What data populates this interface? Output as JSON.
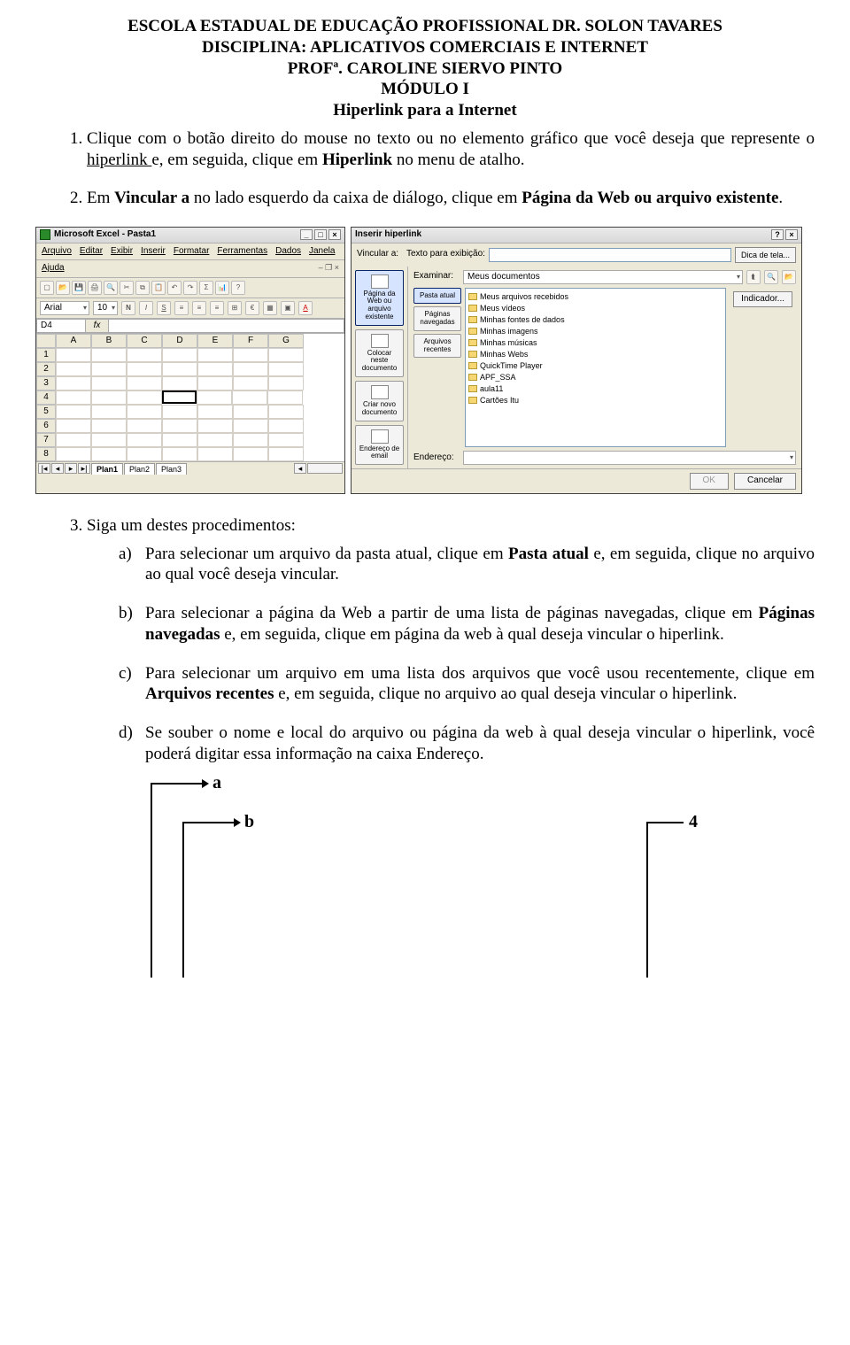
{
  "header": {
    "school": "ESCOLA ESTADUAL DE EDUCAÇÃO PROFISSIONAL DR. SOLON  TAVARES",
    "discipline": "DISCIPLINA: APLICATIVOS COMERCIAIS E INTERNET",
    "prof": "PROFª. CAROLINE SIERVO PINTO",
    "module": "MÓDULO I",
    "title": "Hiperlink para a Internet"
  },
  "steps": {
    "s1_pre": "Clique com o botão direito do mouse no texto ou no elemento gráfico que você deseja que represente o ",
    "s1_link": "hiperlink ",
    "s1_mid": "e, em seguida, clique em ",
    "s1_bold": "Hiperlink",
    "s1_post": " no menu de atalho.",
    "s2_pre": "Em ",
    "s2_b1": "Vincular a",
    "s2_mid": " no lado esquerdo da caixa de diálogo, clique em ",
    "s2_b2": "Página da Web ou arquivo existente",
    "s2_post": ".",
    "s3": "Siga um destes procedimentos:",
    "a_pre": "Para selecionar um arquivo da pasta atual, clique em ",
    "a_b": "Pasta atual",
    "a_post": " e, em seguida, clique no arquivo ao qual você deseja vincular.",
    "b_pre": "Para selecionar a página da Web a partir de uma lista de páginas navegadas, clique em ",
    "b_b": "Páginas navegadas",
    "b_post": " e, em seguida, clique em página da web à qual deseja vincular o hiperlink.",
    "c_pre": "Para selecionar um arquivo em uma lista dos arquivos que você usou recentemente, clique em ",
    "c_b": "Arquivos recentes",
    "c_post": " e, em seguida, clique no arquivo ao qual deseja vincular o hiperlink.",
    "d": "Se souber o nome e local do arquivo ou página da web à qual deseja vincular o hiperlink, você poderá digitar essa informação na caixa Endereço."
  },
  "diagram": {
    "a": "a",
    "b": "b",
    "four": "4"
  },
  "excel": {
    "title": "Microsoft Excel - Pasta1",
    "menus": [
      "Arquivo",
      "Editar",
      "Exibir",
      "Inserir",
      "Formatar",
      "Ferramentas",
      "Dados",
      "Janela",
      "Ajuda"
    ],
    "font": "Arial",
    "size": "10",
    "namebox": "D4",
    "fx": "fx",
    "cols": [
      "A",
      "B",
      "C",
      "D",
      "E",
      "F",
      "G"
    ],
    "rows": [
      "1",
      "2",
      "3",
      "4",
      "5",
      "6",
      "7",
      "8"
    ],
    "sheets": [
      "Plan1",
      "Plan2",
      "Plan3"
    ]
  },
  "dialog": {
    "title": "Inserir hiperlink",
    "vincular_lbl": "Vincular a:",
    "texto_lbl": "Texto para exibição:",
    "dica_btn": "Dica de tela...",
    "examinar_lbl": "Examinar:",
    "examinar_val": "Meus documentos",
    "indicador_btn": "Indicador...",
    "linkbar": [
      "Página da Web ou arquivo existente",
      "Colocar neste documento",
      "Criar novo documento",
      "Endereço de email"
    ],
    "sidebtns": [
      "Pasta atual",
      "Páginas navegadas",
      "Arquivos recentes"
    ],
    "files": [
      "Meus arquivos recebidos",
      "Meus vídeos",
      "Minhas fontes de dados",
      "Minhas imagens",
      "Minhas músicas",
      "Minhas Webs",
      "QuickTime Player",
      "APF_SSA",
      "aula11",
      "Cartões Itu"
    ],
    "endereco_lbl": "Endereço:",
    "ok": "OK",
    "cancel": "Cancelar"
  }
}
